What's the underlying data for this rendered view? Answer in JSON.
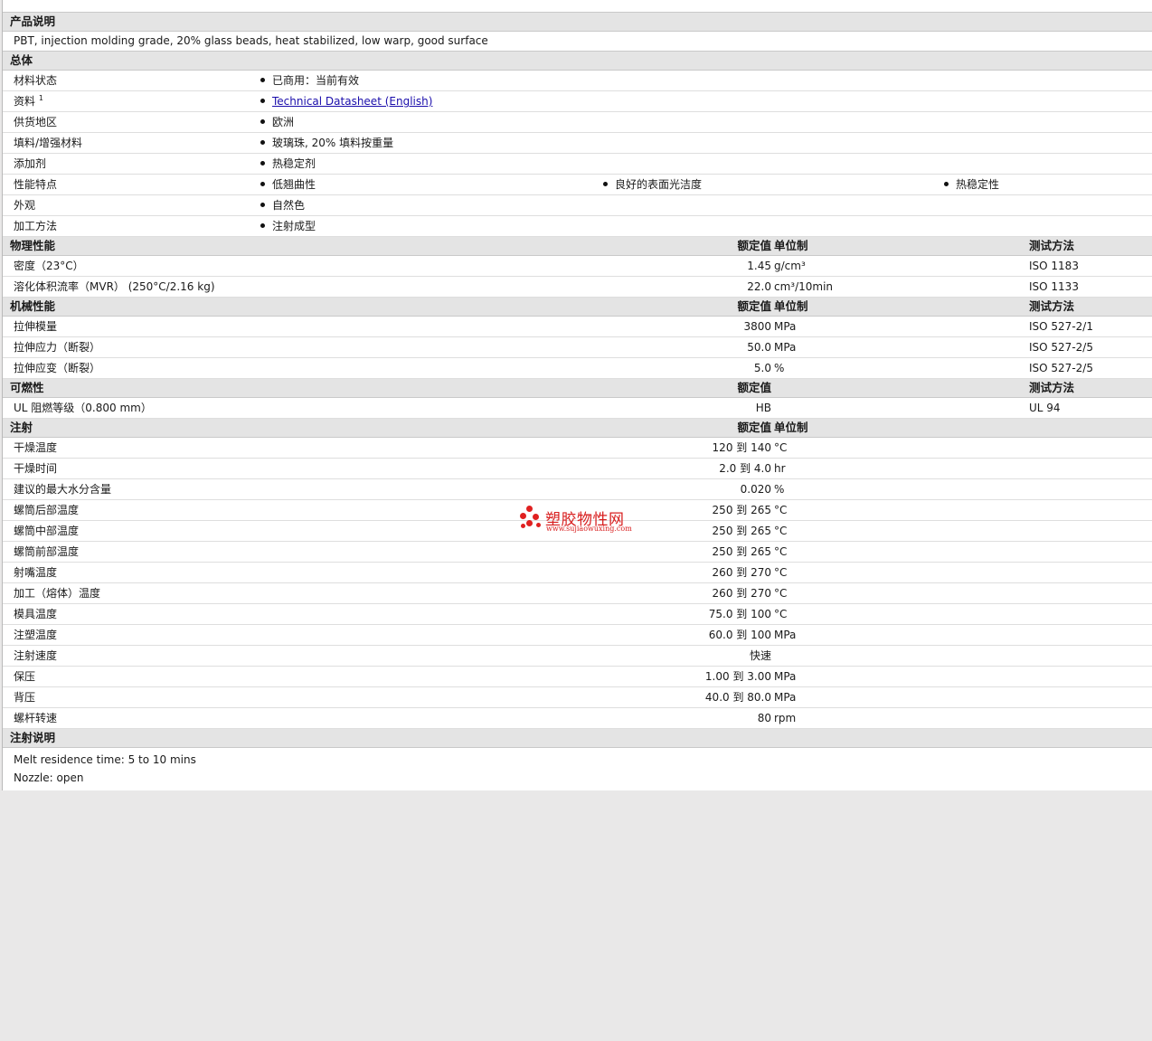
{
  "description": {
    "header": "产品说明",
    "text": "PBT, injection molding grade, 20% glass beads, heat stabilized, low warp, good surface"
  },
  "general": {
    "header": "总体",
    "rows": [
      {
        "label": "材料状态",
        "values": [
          "已商用：当前有效"
        ]
      },
      {
        "label": "资料",
        "sup": "1",
        "link": "Technical Datasheet (English)"
      },
      {
        "label": "供货地区",
        "values": [
          "欧洲"
        ]
      },
      {
        "label": "填料/增强材料",
        "values": [
          "玻璃珠, 20% 填料按重量"
        ]
      },
      {
        "label": "添加剂",
        "values": [
          "热稳定剂"
        ]
      },
      {
        "label": "性能特点",
        "values": [
          "低翘曲性",
          "良好的表面光洁度",
          "热稳定性"
        ]
      },
      {
        "label": "外观",
        "values": [
          "自然色"
        ]
      },
      {
        "label": "加工方法",
        "values": [
          "注射成型"
        ]
      }
    ]
  },
  "columns": {
    "nominal": "额定值",
    "unit": "单位制",
    "test": "测试方法"
  },
  "physical": {
    "header": "物理性能",
    "rows": [
      {
        "label": "密度（23°C）",
        "nominal": "1.45",
        "unit": "g/cm³",
        "test": "ISO 1183"
      },
      {
        "label": "溶化体积流率（MVR） (250°C/2.16 kg)",
        "nominal": "22.0",
        "unit": "cm³/10min",
        "test": "ISO 1133"
      }
    ]
  },
  "mechanical": {
    "header": "机械性能",
    "rows": [
      {
        "label": "拉伸模量",
        "nominal": "3800",
        "unit": "MPa",
        "test": "ISO 527-2/1"
      },
      {
        "label": "拉伸应力（断裂）",
        "nominal": "50.0",
        "unit": "MPa",
        "test": "ISO 527-2/5"
      },
      {
        "label": "拉伸应变（断裂）",
        "nominal": "5.0",
        "unit": "%",
        "test": "ISO 527-2/5"
      }
    ]
  },
  "flammability": {
    "header": "可燃性",
    "rows": [
      {
        "label": "UL 阻燃等级（0.800 mm）",
        "nominal": "HB",
        "unit": "",
        "test": "UL 94"
      }
    ]
  },
  "injection": {
    "header": "注射",
    "rows": [
      {
        "label": "干燥温度",
        "nominal": "120 到  140",
        "unit": "°C"
      },
      {
        "label": "干燥时间",
        "nominal": "2.0 到  4.0",
        "unit": "hr"
      },
      {
        "label": "建议的最大水分含量",
        "nominal": "0.020",
        "unit": "%"
      },
      {
        "label": "螺筒后部温度",
        "nominal": "250 到  265",
        "unit": "°C"
      },
      {
        "label": "螺筒中部温度",
        "nominal": "250 到  265",
        "unit": "°C"
      },
      {
        "label": "螺筒前部温度",
        "nominal": "250 到  265",
        "unit": "°C"
      },
      {
        "label": "射嘴温度",
        "nominal": "260 到  270",
        "unit": "°C"
      },
      {
        "label": "加工（熔体）温度",
        "nominal": "260 到  270",
        "unit": "°C"
      },
      {
        "label": "模具温度",
        "nominal": "75.0 到  100",
        "unit": "°C"
      },
      {
        "label": "注塑温度",
        "nominal": "60.0 到  100",
        "unit": "MPa"
      },
      {
        "label": "注射速度",
        "nominal": "快速",
        "unit": ""
      },
      {
        "label": "保压",
        "nominal": "1.00 到  3.00",
        "unit": "MPa"
      },
      {
        "label": "背压",
        "nominal": "40.0 到  80.0",
        "unit": "MPa"
      },
      {
        "label": "螺杆转速",
        "nominal": "80",
        "unit": "rpm"
      }
    ]
  },
  "injection_notes": {
    "header": "注射说明",
    "lines": [
      "Melt residence time: 5 to 10 mins",
      "Nozzle: open"
    ]
  },
  "watermark": {
    "title": "塑胶物性网",
    "url": "www.sujiaowuxing.com",
    "color": "#d81e1e"
  }
}
